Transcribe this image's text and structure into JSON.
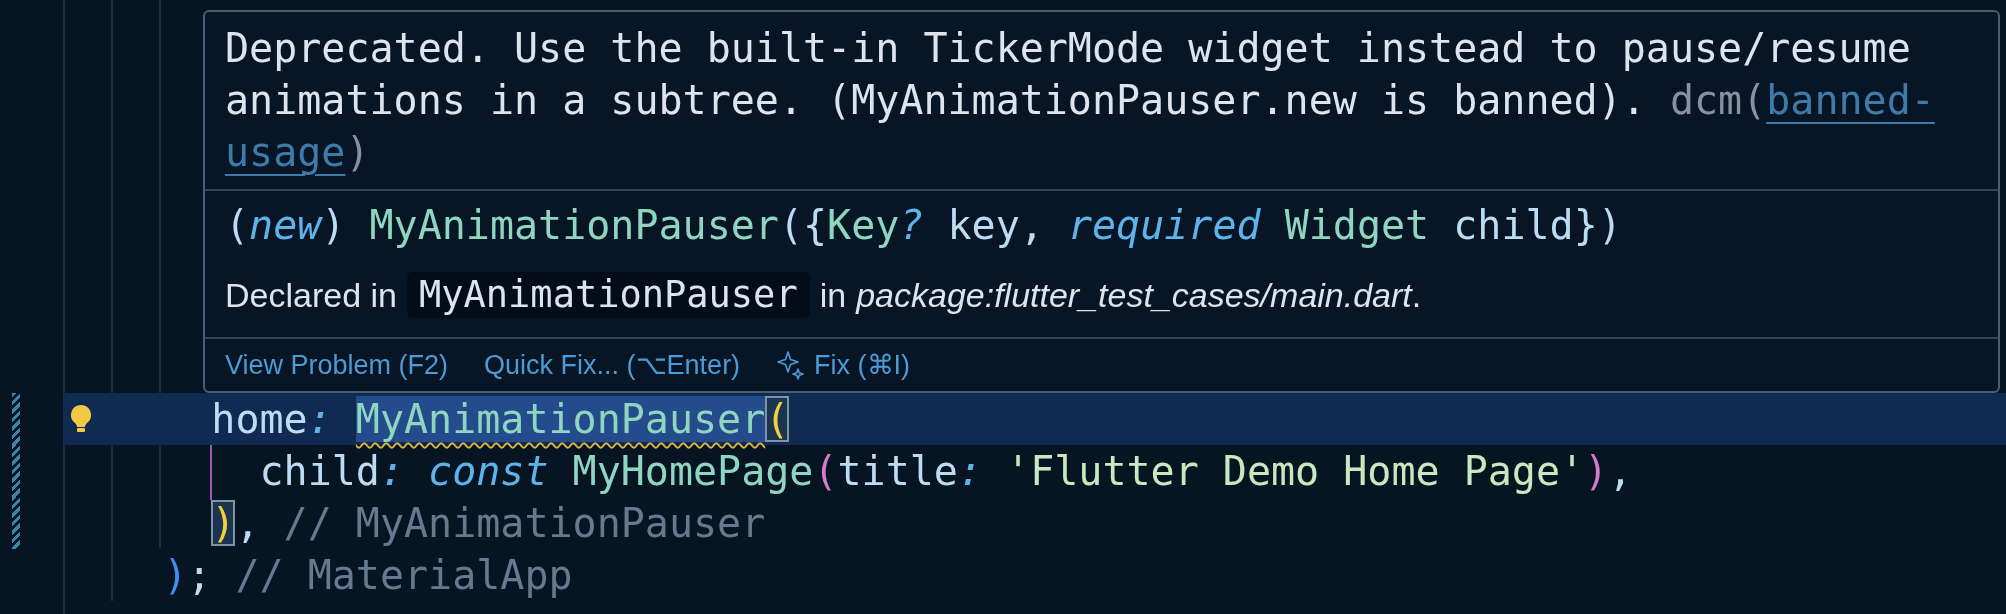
{
  "editor": {
    "lines": [
      {
        "modified": true,
        "current": true,
        "lightbulb": true,
        "tokens": [
          {
            "text": "    home",
            "kind": "property"
          },
          {
            "text": ": ",
            "kind": "colon"
          },
          {
            "text": "MyAnimationPauser",
            "kind": "selected-warning-type"
          },
          {
            "text": "(",
            "kind": "selected-matched-bracket-yellow"
          }
        ]
      },
      {
        "modified": true,
        "current": false,
        "lightbulb": false,
        "tokens": [
          {
            "text": "      child",
            "kind": "property"
          },
          {
            "text": ": ",
            "kind": "colon"
          },
          {
            "text": "const ",
            "kind": "keyword"
          },
          {
            "text": "MyHomePage",
            "kind": "type"
          },
          {
            "text": "(",
            "kind": "bracket-pink"
          },
          {
            "text": "title",
            "kind": "property"
          },
          {
            "text": ": ",
            "kind": "colon"
          },
          {
            "text": "'Flutter Demo Home Page'",
            "kind": "string"
          },
          {
            "text": ")",
            "kind": "bracket-pink"
          },
          {
            "text": ",",
            "kind": "punct"
          }
        ]
      },
      {
        "modified": true,
        "current": false,
        "lightbulb": false,
        "tokens": [
          {
            "text": "    )",
            "kind": "matched-bracket-yellow"
          },
          {
            "text": ",",
            "kind": "punct"
          },
          {
            "text": " // MyAnimationPauser",
            "kind": "hint"
          }
        ]
      },
      {
        "modified": false,
        "current": false,
        "lightbulb": false,
        "tokens": [
          {
            "text": "  )",
            "kind": "bracket-blue"
          },
          {
            "text": ";",
            "kind": "punct"
          },
          {
            "text": " // MaterialApp",
            "kind": "hint"
          }
        ]
      }
    ]
  },
  "hover": {
    "message": "Deprecated. Use the built-in TickerMode widget instead to pause/resume animations in a subtree. (MyAnimationPauser.new is banned).",
    "source": "dcm(",
    "rule_link_parts": [
      "banned-",
      "usage"
    ],
    "source_end": ")",
    "signature": [
      {
        "text": "(",
        "kind": "punct"
      },
      {
        "text": "new",
        "kind": "keyword"
      },
      {
        "text": ") ",
        "kind": "punct"
      },
      {
        "text": "MyAnimationPauser",
        "kind": "type"
      },
      {
        "text": "({",
        "kind": "punct"
      },
      {
        "text": "Key",
        "kind": "type"
      },
      {
        "text": "?",
        "kind": "keyword"
      },
      {
        "text": " key, ",
        "kind": "punct"
      },
      {
        "text": "required",
        "kind": "keyword"
      },
      {
        "text": " Widget",
        "kind": "type"
      },
      {
        "text": " child})",
        "kind": "punct"
      }
    ],
    "declared_prefix": "Declared in",
    "declared_class": "MyAnimationPauser",
    "declared_middle": "in",
    "declared_location": "package:flutter_test_cases/main.dart",
    "declared_end": ".",
    "actions": [
      {
        "label": "View Problem (F2)",
        "kind": "plain"
      },
      {
        "label": "Quick Fix... (⌥Enter)",
        "kind": "plain"
      },
      {
        "label": "Fix (⌘I)",
        "kind": "sparkle"
      }
    ]
  }
}
